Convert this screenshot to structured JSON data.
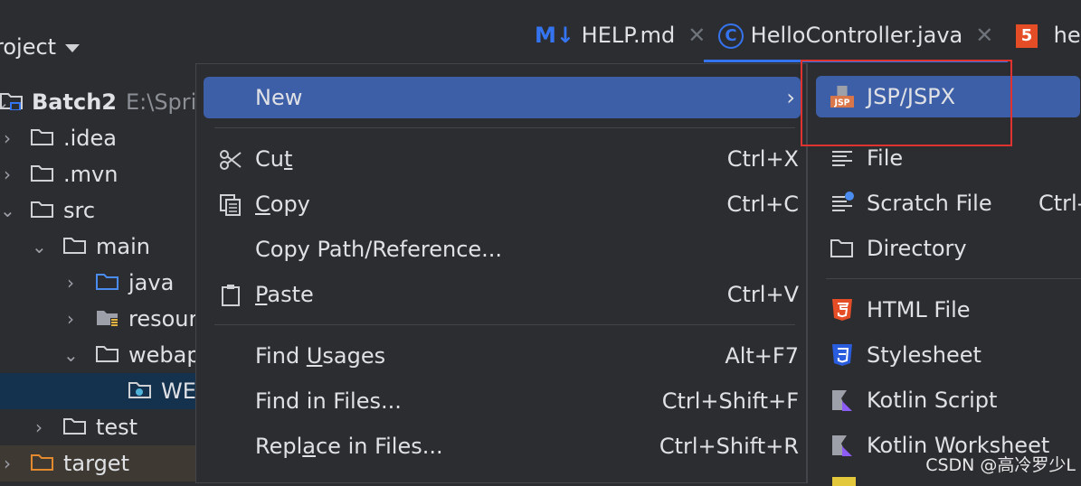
{
  "project": {
    "title": "roject",
    "tree": [
      {
        "label": "Batch2",
        "path": "E:\\Sprin"
      },
      {
        "label": ".idea"
      },
      {
        "label": ".mvn"
      },
      {
        "label": "src"
      },
      {
        "label": "main"
      },
      {
        "label": "java"
      },
      {
        "label": "resour"
      },
      {
        "label": "webap"
      },
      {
        "label": "WE"
      },
      {
        "label": "test"
      },
      {
        "label": "target"
      }
    ]
  },
  "tabs": [
    {
      "icon": "M↓",
      "label": "HELP.md"
    },
    {
      "icon": "C",
      "label": "HelloController.java"
    },
    {
      "icon": "5",
      "label": "hel"
    }
  ],
  "menu": {
    "new": "New",
    "cut": {
      "pre": "Cu",
      "u": "t",
      "post": "",
      "shortcut": "Ctrl+X"
    },
    "copy": {
      "u": "C",
      "post": "opy",
      "shortcut": "Ctrl+C"
    },
    "copy_path": "Copy Path/Reference...",
    "paste": {
      "u": "P",
      "post": "aste",
      "shortcut": "Ctrl+V"
    },
    "find_usages": {
      "pre": "Find ",
      "u": "U",
      "post": "sages",
      "shortcut": "Alt+F7"
    },
    "find_in_files": {
      "label": "Find in Files...",
      "shortcut": "Ctrl+Shift+F"
    },
    "replace_in_files": {
      "pre": "Repl",
      "u": "a",
      "post": "ce in Files...",
      "shortcut": "Ctrl+Shift+R"
    }
  },
  "submenu": {
    "jsp": "JSP/JSPX",
    "jsp_badge": "JSP",
    "file": "File",
    "scratch": "Scratch File",
    "scratch_shortcut": "Ctrl-",
    "directory": "Directory",
    "html": "HTML File",
    "stylesheet": "Stylesheet",
    "kotlin_script": "Kotlin Script",
    "kotlin_worksheet": "Kotlin Worksheet"
  },
  "watermark": "CSDN @高冷罗少L",
  "colors": {
    "accent": "#3574f0",
    "highlight": "#3d5fa8",
    "red_frame": "#e0322f",
    "folder_blue": "#4a8cf0",
    "folder_orange": "#e28a2d",
    "html_orange": "#e44d26",
    "css_blue": "#2a5ddd"
  }
}
